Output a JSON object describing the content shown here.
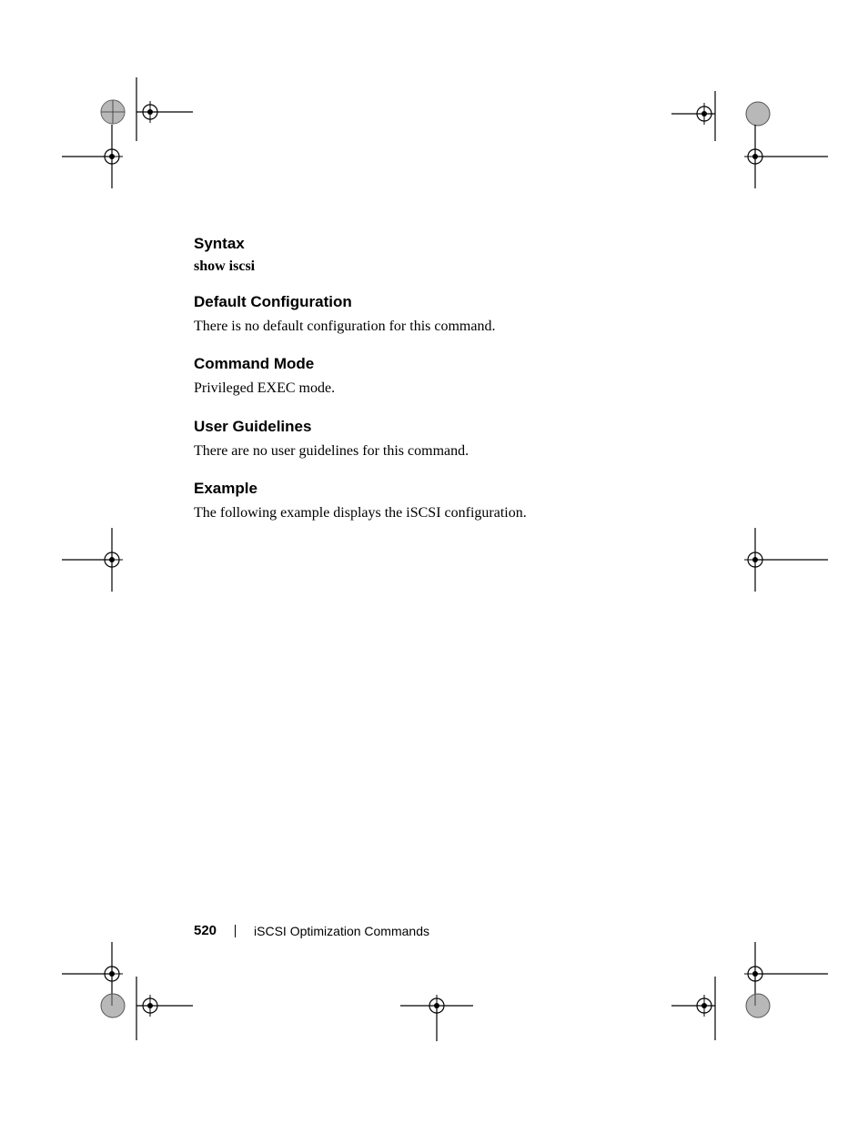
{
  "sections": {
    "syntax": {
      "heading": "Syntax",
      "body": "show iscsi"
    },
    "default_config": {
      "heading": "Default Configuration",
      "body": "There is no default configuration for this command."
    },
    "command_mode": {
      "heading": "Command Mode",
      "body": "Privileged EXEC mode."
    },
    "user_guidelines": {
      "heading": "User Guidelines",
      "body": "There are no user guidelines for this command."
    },
    "example": {
      "heading": "Example",
      "body": "The following example displays the iSCSI configuration."
    }
  },
  "footer": {
    "page_number": "520",
    "section_title": "iSCSI Optimization Commands"
  }
}
